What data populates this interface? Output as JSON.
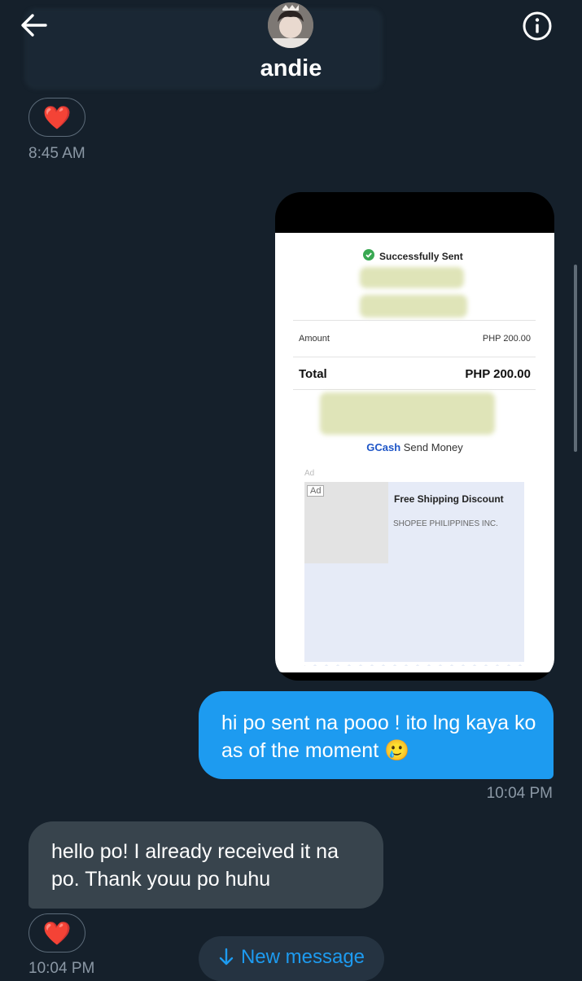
{
  "header": {
    "contact_name": "andie",
    "icons": {
      "back": "arrow-left-icon",
      "info": "info-circle-icon"
    }
  },
  "messages": {
    "first_reaction": "❤️",
    "first_timestamp": "8:45 AM",
    "receipt": {
      "status_label": "Successfully Sent",
      "amount_label": "Amount",
      "amount_value": "PHP 200.00",
      "total_label": "Total",
      "total_value": "PHP 200.00",
      "service_brand": "GCash",
      "service_label": "Send Money",
      "ad_label": "Ad",
      "ad_badge": "Ad",
      "ad_title": "Free Shipping Discount",
      "ad_advertiser": "SHOPEE PHILIPPINES INC."
    },
    "outgoing_text": "hi po sent na pooo ! ito lng kaya ko as of the moment 🥲",
    "outgoing_timestamp": "10:04 PM",
    "incoming_text": "hello po! I already received it na po. Thank youu po huhu",
    "second_reaction": "❤️",
    "second_timestamp": "10:04 PM"
  },
  "new_message_button": {
    "label": "New message",
    "icon": "arrow-down-icon"
  },
  "colors": {
    "background": "#15202b",
    "accent": "#1d9bf0",
    "incoming_bubble": "#38444d",
    "muted_text": "#8b98a5"
  }
}
